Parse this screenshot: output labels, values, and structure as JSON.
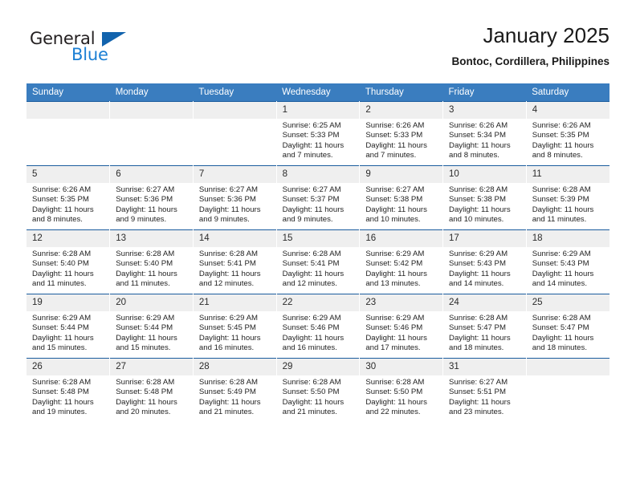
{
  "brand": {
    "name_part1": "General",
    "name_part2": "Blue"
  },
  "header": {
    "title": "January 2025",
    "subtitle": "Bontoc, Cordillera, Philippines"
  },
  "colors": {
    "header_row": "#3a7dbf",
    "row_divider": "#1a5c9e",
    "daynum_background": "#efefef",
    "brand_blue": "#1b7fd4",
    "brand_dark": "#231f20"
  },
  "weekday_headers": [
    "Sunday",
    "Monday",
    "Tuesday",
    "Wednesday",
    "Thursday",
    "Friday",
    "Saturday"
  ],
  "weeks": [
    [
      {
        "day": "",
        "blank": true,
        "sunrise": "",
        "sunset": "",
        "daylight": ""
      },
      {
        "day": "",
        "blank": true,
        "sunrise": "",
        "sunset": "",
        "daylight": ""
      },
      {
        "day": "",
        "blank": true,
        "sunrise": "",
        "sunset": "",
        "daylight": ""
      },
      {
        "day": "1",
        "blank": false,
        "sunrise": "Sunrise: 6:25 AM",
        "sunset": "Sunset: 5:33 PM",
        "daylight": "Daylight: 11 hours and 7 minutes."
      },
      {
        "day": "2",
        "blank": false,
        "sunrise": "Sunrise: 6:26 AM",
        "sunset": "Sunset: 5:33 PM",
        "daylight": "Daylight: 11 hours and 7 minutes."
      },
      {
        "day": "3",
        "blank": false,
        "sunrise": "Sunrise: 6:26 AM",
        "sunset": "Sunset: 5:34 PM",
        "daylight": "Daylight: 11 hours and 8 minutes."
      },
      {
        "day": "4",
        "blank": false,
        "sunrise": "Sunrise: 6:26 AM",
        "sunset": "Sunset: 5:35 PM",
        "daylight": "Daylight: 11 hours and 8 minutes."
      }
    ],
    [
      {
        "day": "5",
        "blank": false,
        "sunrise": "Sunrise: 6:26 AM",
        "sunset": "Sunset: 5:35 PM",
        "daylight": "Daylight: 11 hours and 8 minutes."
      },
      {
        "day": "6",
        "blank": false,
        "sunrise": "Sunrise: 6:27 AM",
        "sunset": "Sunset: 5:36 PM",
        "daylight": "Daylight: 11 hours and 9 minutes."
      },
      {
        "day": "7",
        "blank": false,
        "sunrise": "Sunrise: 6:27 AM",
        "sunset": "Sunset: 5:36 PM",
        "daylight": "Daylight: 11 hours and 9 minutes."
      },
      {
        "day": "8",
        "blank": false,
        "sunrise": "Sunrise: 6:27 AM",
        "sunset": "Sunset: 5:37 PM",
        "daylight": "Daylight: 11 hours and 9 minutes."
      },
      {
        "day": "9",
        "blank": false,
        "sunrise": "Sunrise: 6:27 AM",
        "sunset": "Sunset: 5:38 PM",
        "daylight": "Daylight: 11 hours and 10 minutes."
      },
      {
        "day": "10",
        "blank": false,
        "sunrise": "Sunrise: 6:28 AM",
        "sunset": "Sunset: 5:38 PM",
        "daylight": "Daylight: 11 hours and 10 minutes."
      },
      {
        "day": "11",
        "blank": false,
        "sunrise": "Sunrise: 6:28 AM",
        "sunset": "Sunset: 5:39 PM",
        "daylight": "Daylight: 11 hours and 11 minutes."
      }
    ],
    [
      {
        "day": "12",
        "blank": false,
        "sunrise": "Sunrise: 6:28 AM",
        "sunset": "Sunset: 5:40 PM",
        "daylight": "Daylight: 11 hours and 11 minutes."
      },
      {
        "day": "13",
        "blank": false,
        "sunrise": "Sunrise: 6:28 AM",
        "sunset": "Sunset: 5:40 PM",
        "daylight": "Daylight: 11 hours and 11 minutes."
      },
      {
        "day": "14",
        "blank": false,
        "sunrise": "Sunrise: 6:28 AM",
        "sunset": "Sunset: 5:41 PM",
        "daylight": "Daylight: 11 hours and 12 minutes."
      },
      {
        "day": "15",
        "blank": false,
        "sunrise": "Sunrise: 6:28 AM",
        "sunset": "Sunset: 5:41 PM",
        "daylight": "Daylight: 11 hours and 12 minutes."
      },
      {
        "day": "16",
        "blank": false,
        "sunrise": "Sunrise: 6:29 AM",
        "sunset": "Sunset: 5:42 PM",
        "daylight": "Daylight: 11 hours and 13 minutes."
      },
      {
        "day": "17",
        "blank": false,
        "sunrise": "Sunrise: 6:29 AM",
        "sunset": "Sunset: 5:43 PM",
        "daylight": "Daylight: 11 hours and 14 minutes."
      },
      {
        "day": "18",
        "blank": false,
        "sunrise": "Sunrise: 6:29 AM",
        "sunset": "Sunset: 5:43 PM",
        "daylight": "Daylight: 11 hours and 14 minutes."
      }
    ],
    [
      {
        "day": "19",
        "blank": false,
        "sunrise": "Sunrise: 6:29 AM",
        "sunset": "Sunset: 5:44 PM",
        "daylight": "Daylight: 11 hours and 15 minutes."
      },
      {
        "day": "20",
        "blank": false,
        "sunrise": "Sunrise: 6:29 AM",
        "sunset": "Sunset: 5:44 PM",
        "daylight": "Daylight: 11 hours and 15 minutes."
      },
      {
        "day": "21",
        "blank": false,
        "sunrise": "Sunrise: 6:29 AM",
        "sunset": "Sunset: 5:45 PM",
        "daylight": "Daylight: 11 hours and 16 minutes."
      },
      {
        "day": "22",
        "blank": false,
        "sunrise": "Sunrise: 6:29 AM",
        "sunset": "Sunset: 5:46 PM",
        "daylight": "Daylight: 11 hours and 16 minutes."
      },
      {
        "day": "23",
        "blank": false,
        "sunrise": "Sunrise: 6:29 AM",
        "sunset": "Sunset: 5:46 PM",
        "daylight": "Daylight: 11 hours and 17 minutes."
      },
      {
        "day": "24",
        "blank": false,
        "sunrise": "Sunrise: 6:28 AM",
        "sunset": "Sunset: 5:47 PM",
        "daylight": "Daylight: 11 hours and 18 minutes."
      },
      {
        "day": "25",
        "blank": false,
        "sunrise": "Sunrise: 6:28 AM",
        "sunset": "Sunset: 5:47 PM",
        "daylight": "Daylight: 11 hours and 18 minutes."
      }
    ],
    [
      {
        "day": "26",
        "blank": false,
        "sunrise": "Sunrise: 6:28 AM",
        "sunset": "Sunset: 5:48 PM",
        "daylight": "Daylight: 11 hours and 19 minutes."
      },
      {
        "day": "27",
        "blank": false,
        "sunrise": "Sunrise: 6:28 AM",
        "sunset": "Sunset: 5:48 PM",
        "daylight": "Daylight: 11 hours and 20 minutes."
      },
      {
        "day": "28",
        "blank": false,
        "sunrise": "Sunrise: 6:28 AM",
        "sunset": "Sunset: 5:49 PM",
        "daylight": "Daylight: 11 hours and 21 minutes."
      },
      {
        "day": "29",
        "blank": false,
        "sunrise": "Sunrise: 6:28 AM",
        "sunset": "Sunset: 5:50 PM",
        "daylight": "Daylight: 11 hours and 21 minutes."
      },
      {
        "day": "30",
        "blank": false,
        "sunrise": "Sunrise: 6:28 AM",
        "sunset": "Sunset: 5:50 PM",
        "daylight": "Daylight: 11 hours and 22 minutes."
      },
      {
        "day": "31",
        "blank": false,
        "sunrise": "Sunrise: 6:27 AM",
        "sunset": "Sunset: 5:51 PM",
        "daylight": "Daylight: 11 hours and 23 minutes."
      },
      {
        "day": "",
        "blank": true,
        "sunrise": "",
        "sunset": "",
        "daylight": ""
      }
    ]
  ]
}
